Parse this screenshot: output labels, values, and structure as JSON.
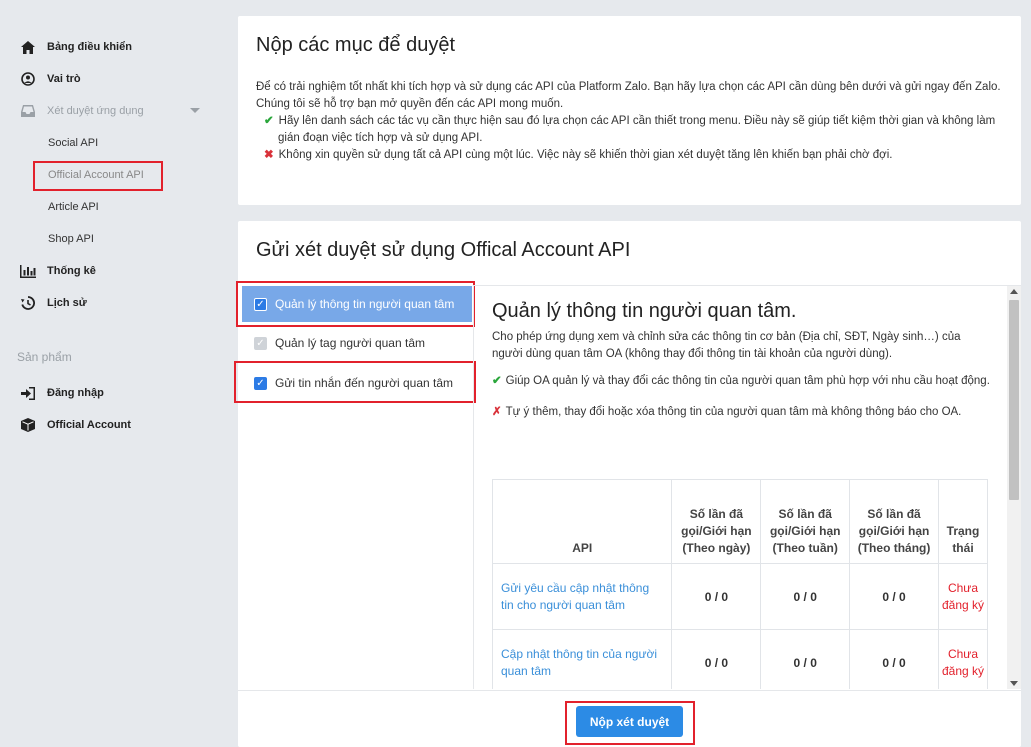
{
  "sidebar": {
    "items": [
      {
        "label": "Bảng điều khiển",
        "icon": "home-icon"
      },
      {
        "label": "Vai trò",
        "icon": "user-circle-icon"
      },
      {
        "label": "Xét duyệt ứng dụng",
        "icon": "inbox-icon"
      }
    ],
    "sub_items": [
      "Social API",
      "Official Account API",
      "Article API",
      "Shop API"
    ],
    "items2": [
      {
        "label": "Thống kê",
        "icon": "bar-chart-icon"
      },
      {
        "label": "Lịch sử",
        "icon": "history-icon"
      }
    ],
    "section_label": "Sản phẩm",
    "product_items": [
      {
        "label": "Đăng nhập",
        "icon": "sign-in-icon"
      },
      {
        "label": "Official Account",
        "icon": "cube-icon"
      }
    ]
  },
  "intro": {
    "title": "Nộp các mục để duyệt",
    "description": "Để có trải nghiệm tốt nhất khi tích hợp và sử dụng các API của Platform Zalo. Bạn hãy lựa chọn các API cần dùng bên dưới và gửi ngay đến Zalo. Chúng tôi sẽ hỗ trợ bạn mở quyền đến các API mong muốn.",
    "tip_good": "Hãy lên danh sách các tác vụ cần thực hiện sau đó lựa chọn các API cần thiết trong menu. Điều này sẽ giúp tiết kiệm thời gian và không làm gián đoạn việc tích hợp và sử dụng API.",
    "tip_bad": "Không xin quyền sử dụng tất cả API cùng một lúc. Việc này sẽ khiến thời gian xét duyệt tăng lên khiến bạn phải chờ đợi."
  },
  "review": {
    "title": "Gửi xét duyệt sử dụng Offical Account API",
    "options": [
      {
        "label": "Quản lý thông tin người quan tâm",
        "state": "selected"
      },
      {
        "label": "Quản lý tag người quan tâm",
        "state": "disabled"
      },
      {
        "label": "Gửi tin nhắn đến người quan tâm",
        "state": "checked"
      }
    ],
    "detail": {
      "title": "Quản lý thông tin người quan tâm.",
      "description": "Cho phép ứng dụng xem và chỉnh sửa các thông tin cơ bản (Địa chỉ, SĐT, Ngày sinh…) của người dùng quan tâm OA (không thay đổi thông tin tài khoản của người dùng).",
      "good": "Giúp OA quản lý và thay đổi các thông tin của người quan tâm phù hợp với nhu cầu hoạt động.",
      "bad": "Tự ý thêm, thay đổi hoặc xóa thông tin của người quan tâm mà không thông báo cho OA.",
      "table": {
        "headers": [
          "API",
          "Số lần đã gọi/Giới hạn (Theo ngày)",
          "Số lần đã gọi/Giới hạn (Theo tuần)",
          "Số lần đã gọi/Giới hạn (Theo tháng)",
          "Trạng thái"
        ],
        "rows": [
          [
            "Gửi yêu cầu cập nhật thông tin cho người quan tâm",
            "0 / 0",
            "0 / 0",
            "0 / 0",
            "Chưa đăng ký"
          ],
          [
            "Cập nhật thông tin của người quan tâm",
            "0 / 0",
            "0 / 0",
            "0 / 0",
            "Chưa đăng ký"
          ]
        ]
      }
    },
    "submit_label": "Nộp xét duyệt"
  },
  "colors": {
    "accent": "#2c8be5",
    "highlight": "#e2212c",
    "selected_bg": "#78a8e8",
    "link": "#3a8fd9"
  }
}
